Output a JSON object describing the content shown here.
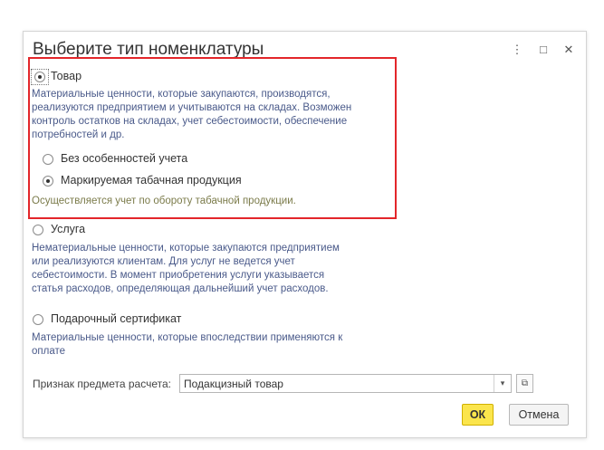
{
  "dialog": {
    "title": "Выберите тип номенклатуры",
    "menu_glyph": "⋮",
    "maximize_glyph": "□",
    "close_glyph": "✕"
  },
  "options": {
    "goods": {
      "label": "Товар",
      "selected": true,
      "description": [
        "Материальные ценности, которые закупаются, производятся,",
        "реализуются предприятием и учитываются на складах. Возможен",
        "контроль остатков на складах, учет себестоимости, обеспечение",
        "потребностей и др."
      ],
      "sub_options": [
        {
          "label": "Без особенностей учета",
          "selected": false
        },
        {
          "label": "Маркируемая табачная продукция",
          "selected": true
        }
      ],
      "note": "Осуществляется учет по обороту табачной продукции."
    },
    "service": {
      "label": "Услуга",
      "selected": false,
      "description": [
        "Нематериальные ценности, которые закупаются предприятием",
        "или реализуются клиентам. Для услуг не ведется учет",
        "себестоимости. В момент приобретения услуги указывается",
        "статья расходов, определяющая дальнейший учет расходов."
      ]
    },
    "gift_certificate": {
      "label": "Подарочный сертификат",
      "selected": false,
      "description": [
        "Материальные ценности, которые впоследствии применяются к",
        "оплате"
      ]
    }
  },
  "payment_subject": {
    "label": "Признак предмета расчета:",
    "value": "Подакцизный товар",
    "dropdown_glyph": "▾",
    "open_glyph": "⧉"
  },
  "buttons": {
    "ok": "ОК",
    "cancel": "Отмена"
  },
  "colors": {
    "highlight": "#e3262a",
    "ok_button": "#fbe54c",
    "description_text": "#4a5a8a",
    "note_text": "#7b7b4a"
  }
}
